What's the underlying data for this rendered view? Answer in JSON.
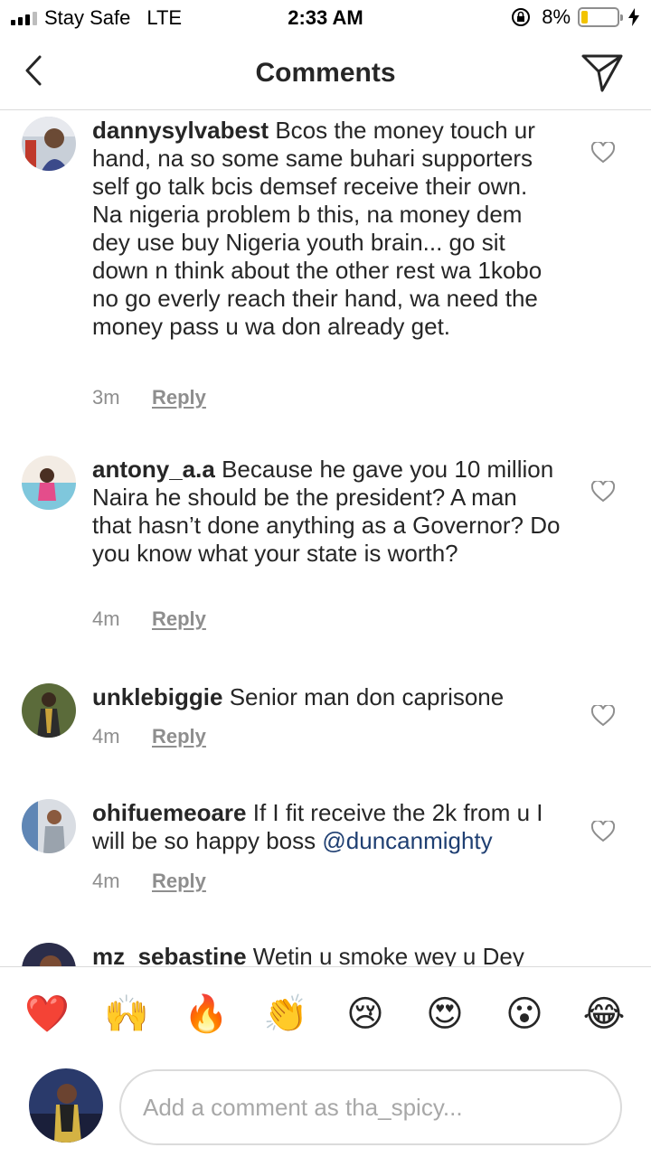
{
  "status_bar": {
    "carrier": "Stay Safe",
    "network": "LTE",
    "time": "2:33 AM",
    "battery_percent": "8%",
    "battery_level": 0.08,
    "battery_color": "#f2c300"
  },
  "header": {
    "title": "Comments",
    "back_icon": "chevron-left-icon",
    "share_icon": "send-icon"
  },
  "comments": [
    {
      "username": "dannysylvabest",
      "text": "Bcos the money touch ur hand, na so some same buhari supporters self go talk bcis demsef receive their own. Na nigeria problem b this, na money dem dey use buy Nigeria youth brain... go sit down n think about the other rest wa 1kobo no go everly reach their hand, wa need the money pass u wa don already get.",
      "time": "3m",
      "reply": "Reply"
    },
    {
      "username": "antony_a.a",
      "text": "Because he gave you 10 million Naira he should be the president? A man that hasn’t done anything as a Governor? Do you know what your state is worth?",
      "time": "4m",
      "reply": "Reply"
    },
    {
      "username": "unklebiggie",
      "text": "Senior man don caprisone",
      "time": "4m",
      "reply": "Reply"
    },
    {
      "username": "ohifuemeoare",
      "text": "If I fit receive the 2k from u I will be so happy boss",
      "mention": "@duncanmighty",
      "time": "4m",
      "reply": "Reply"
    },
    {
      "username": "mz_sebastine",
      "text": "Wetin u smoke wey u Dey"
    }
  ],
  "reactions": [
    "❤️",
    "🙌",
    "🔥",
    "👏",
    "😢",
    "😍",
    "😮",
    "😂"
  ],
  "composer": {
    "placeholder": "Add a comment as tha_spicy..."
  },
  "colors": {
    "text": "#262626",
    "secondary": "#8e8e8e",
    "mention": "#1f3f72",
    "divider": "#dbdbdb"
  }
}
